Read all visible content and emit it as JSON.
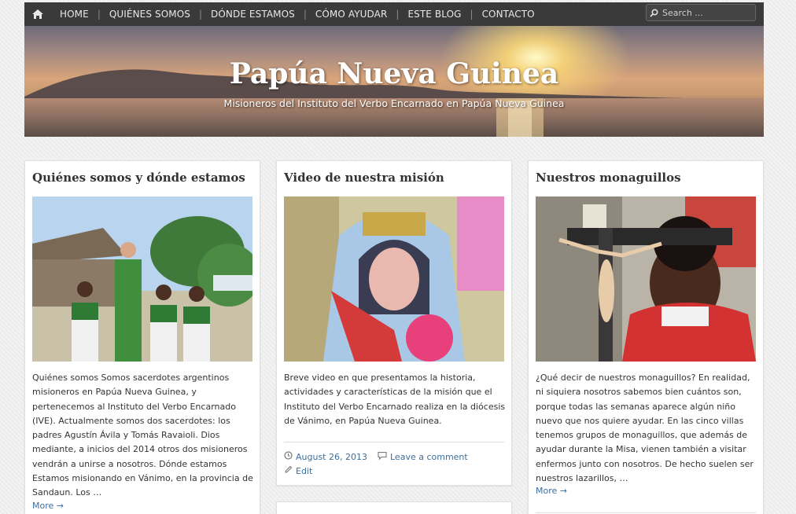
{
  "nav": {
    "items": [
      "HOME",
      "QUIÉNES SOMOS",
      "DÓNDE ESTAMOS",
      "CÓMO AYUDAR",
      "ESTE BLOG",
      "CONTACTO"
    ],
    "search_placeholder": "Search ..."
  },
  "header": {
    "title": "Papúa Nueva Guinea",
    "tagline": "Misioneros del Instituto del Verbo Encarnado en Papúa Nueva Guinea"
  },
  "posts": [
    {
      "title": "Quiénes somos y dónde estamos",
      "excerpt": "Quiénes somos Somos sacerdotes argentinos misioneros en Papúa Nueva Guinea, y pertenecemos al Instituto del Verbo Encarnado (IVE). Actualmente somos dos sacerdotes: los padres Agustín Ávila y Tomás Ravaioli. Dios mediante, a inicios del 2014 otros dos misioneros vendrán a unirse a nosotros. Dónde estamos Estamos misionando en Vánimo, en la provincia de Sandaun. Los …",
      "more": "More →"
    },
    {
      "title": "Video de nuestra misión",
      "excerpt": "Breve video en que presentamos la historia, actividades y características de la misión que el Instituto del Verbo Encarnado realiza en la diócesis de Vánimo, en Papúa Nueva Guinea.",
      "date": "August 26, 2013",
      "comment": "Leave a comment",
      "edit": "Edit"
    },
    {
      "title": "Nuestros monaguillos",
      "excerpt": "¿Qué decir de nuestros monaguillos? En realidad, ni siquiera nosotros sabemos bien cuántos son, porque todas las semanas aparece algún niño nuevo que nos quiere ayudar. En las cinco villas tenemos grupos de monaguillos, que además de ayudar durante la Misa, vienen también a visitar enfermos junto con nosotros. De hecho suelen ser nuestros lazarillos, …",
      "more": "More →"
    }
  ],
  "colors": {
    "nav_bg": "#3a3a3a",
    "link": "#3b6e9e",
    "page_bg": "#ececec"
  }
}
